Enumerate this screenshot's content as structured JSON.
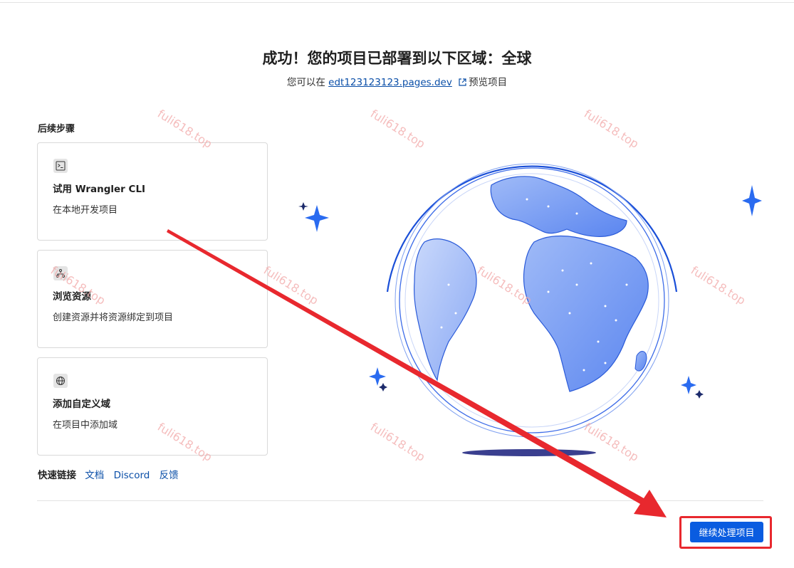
{
  "header": {
    "title": "成功！您的项目已部署到以下区域：全球",
    "subtitle_prefix": "您可以在",
    "site_link": "edt123123123.pages.dev",
    "subtitle_suffix": "预览项目"
  },
  "next_steps": {
    "heading": "后续步骤",
    "cards": [
      {
        "icon": "terminal-icon",
        "title": "试用 Wrangler CLI",
        "description": "在本地开发项目"
      },
      {
        "icon": "resources-icon",
        "title": "浏览资源",
        "description": "创建资源并将资源绑定到项目"
      },
      {
        "icon": "globe-icon",
        "title": "添加自定义域",
        "description": "在项目中添加域"
      }
    ]
  },
  "quick_links": {
    "label": "快速链接",
    "links": [
      "文档",
      "Discord",
      "反馈"
    ]
  },
  "footer": {
    "continue_label": "继续处理项目"
  },
  "watermark": "fuli618.top",
  "colors": {
    "primary": "#0a5ce0",
    "link": "#0b4fa8",
    "annotation_red": "#e8282e",
    "globe_blue": "#5b86f0"
  }
}
